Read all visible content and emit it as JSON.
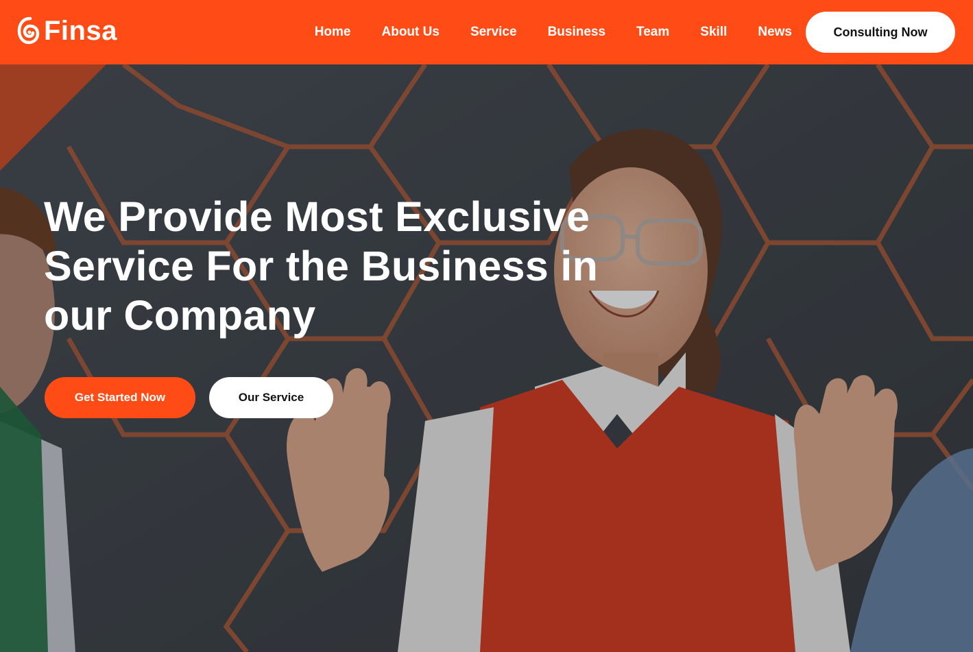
{
  "brand": {
    "name": "Finsa",
    "accent_color": "#ff4c16",
    "icon": "finsa-logo-icon"
  },
  "nav": {
    "items": [
      {
        "label": "Home"
      },
      {
        "label": "About Us"
      },
      {
        "label": "Service"
      },
      {
        "label": "Business"
      },
      {
        "label": "Team"
      },
      {
        "label": "Skill"
      },
      {
        "label": "News"
      }
    ],
    "cta_label": "Consulting Now"
  },
  "hero": {
    "title": "We Provide Most Exclusive Service For the Business in our Company",
    "primary_button": "Get Started Now",
    "secondary_button": "Our Service",
    "background_image": "smiling-woman-waving-with-colleagues"
  }
}
